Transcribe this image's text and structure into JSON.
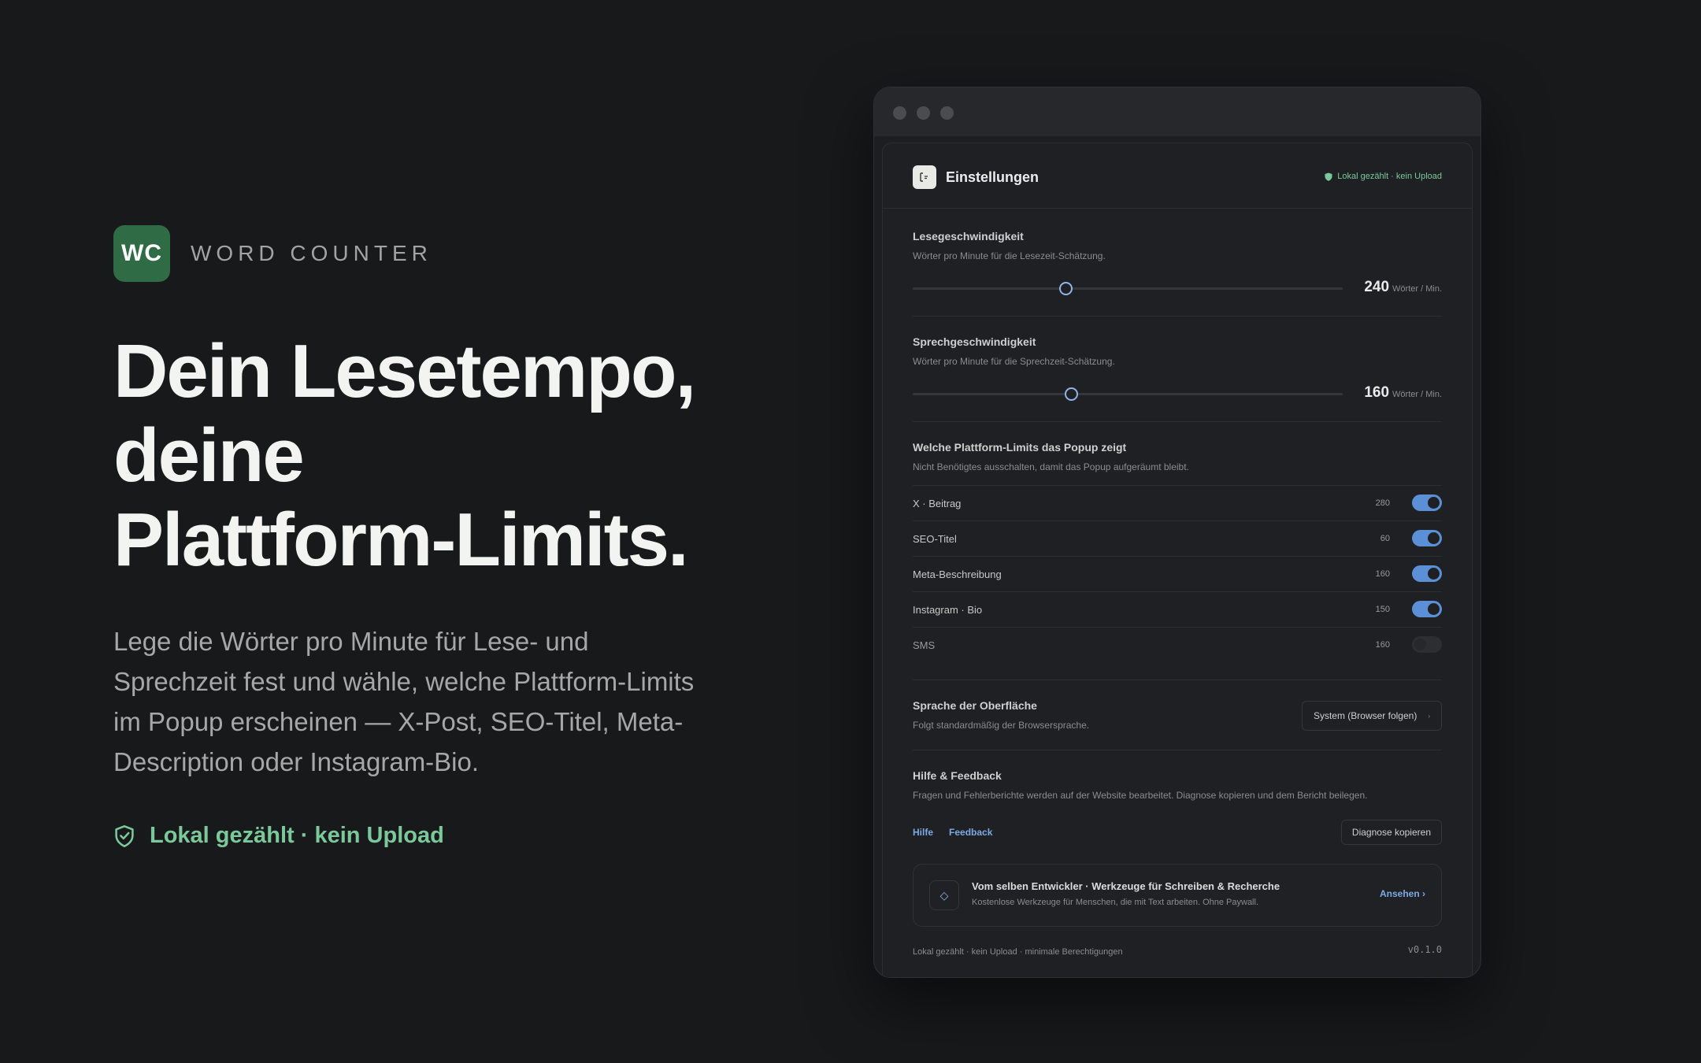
{
  "brand": {
    "logo": "WC",
    "name": "WORD COUNTER"
  },
  "hero": {
    "title_lines": [
      "Dein Lesetempo,",
      "deine",
      "Plattform-Limits."
    ],
    "description": "Lege die Wörter pro Minute für Lese- und Sprechzeit fest und wähle, welche Plattform-Limits im Popup erscheinen — X-Post, SEO-Titel, Meta-Description oder Instagram-Bio.",
    "badge": "Lokal gezählt · kein Upload"
  },
  "settings": {
    "title": "Einstellungen",
    "badge": "Lokal gezählt · kein Upload",
    "reading": {
      "title": "Lesegeschwindigkeit",
      "subtitle": "Wörter pro Minute für die Lesezeit-Schätzung.",
      "value": "240",
      "fraction": 0.355,
      "unit": "Wörter / Min."
    },
    "speaking": {
      "title": "Sprechgeschwindigkeit",
      "subtitle": "Wörter pro Minute für die Sprechzeit-Schätzung.",
      "value": "160",
      "fraction": 0.368,
      "unit": "Wörter / Min."
    },
    "limits": {
      "title": "Welche Plattform-Limits das Popup zeigt",
      "subtitle": "Nicht Benötigtes ausschalten, damit das Popup aufgeräumt bleibt.",
      "items": [
        {
          "label": "X · Beitrag",
          "value": "280",
          "enabled": true
        },
        {
          "label": "SEO-Titel",
          "value": "60",
          "enabled": true
        },
        {
          "label": "Meta-Beschreibung",
          "value": "160",
          "enabled": true
        },
        {
          "label": "Instagram · Bio",
          "value": "150",
          "enabled": true
        },
        {
          "label": "SMS",
          "value": "160",
          "enabled": false
        }
      ]
    },
    "language": {
      "title": "Sprache der Oberfläche",
      "subtitle": "Folgt standardmäßig der Browsersprache.",
      "selected": "System (Browser folgen)"
    },
    "help": {
      "title": "Hilfe & Feedback",
      "subtitle": "Fragen und Fehlerberichte werden auf der Website bearbeitet. Diagnose kopieren und dem Bericht beilegen.",
      "link_help": "Hilfe",
      "link_feedback": "Feedback",
      "copy_button": "Diagnose kopieren"
    },
    "promo": {
      "title": "Vom selben Entwickler · Werkzeuge für Schreiben & Recherche",
      "subtitle": "Kostenlose Werkzeuge für Menschen, die mit Text arbeiten. Ohne Paywall.",
      "cta": "Ansehen ›"
    },
    "footer": {
      "text": "Lokal gezählt · kein Upload · minimale Berechtigungen",
      "version": "v0.1.0"
    }
  },
  "colors": {
    "accent": "#5b8fd6",
    "brand": "#2f6b45",
    "success": "#7bc99b"
  }
}
